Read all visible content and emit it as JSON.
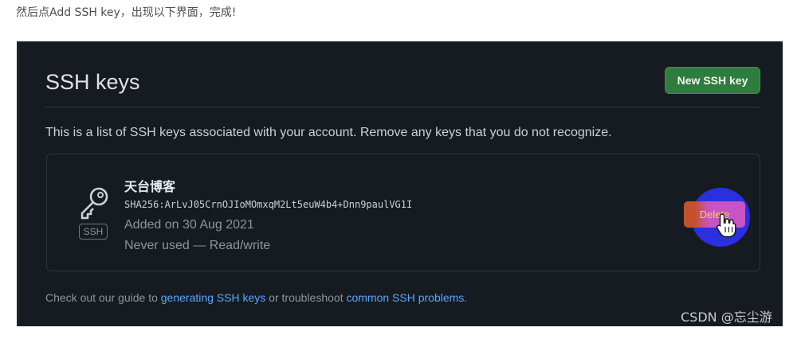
{
  "caption": "然后点Add SSH key，出现以下界面，完成!",
  "page": {
    "title": "SSH keys",
    "new_button": "New SSH key",
    "description": "This is a list of SSH keys associated with your account. Remove any keys that you do not recognize."
  },
  "key": {
    "tag": "SSH",
    "name": "天台博客",
    "fingerprint": "SHA256:ArLvJ05CrnOJIoMOmxqM2Lt5euW4b4+Dnn9paulVG1I",
    "added": "Added on 30 Aug 2021",
    "usage": "Never used — Read/write",
    "delete_button": "Delete"
  },
  "footer": {
    "prefix": "Check out our guide to ",
    "link1": "generating SSH keys",
    "middle": " or troubleshoot ",
    "link2": "common SSH problems",
    "suffix": "."
  },
  "watermark": "CSDN @忘尘游",
  "colors": {
    "background": "#161b22",
    "accent_green": "#2f7d3c",
    "link": "#58a6ff",
    "highlight": "#2a2fe0"
  },
  "icons": [
    "key-icon",
    "pointer-cursor-icon"
  ]
}
